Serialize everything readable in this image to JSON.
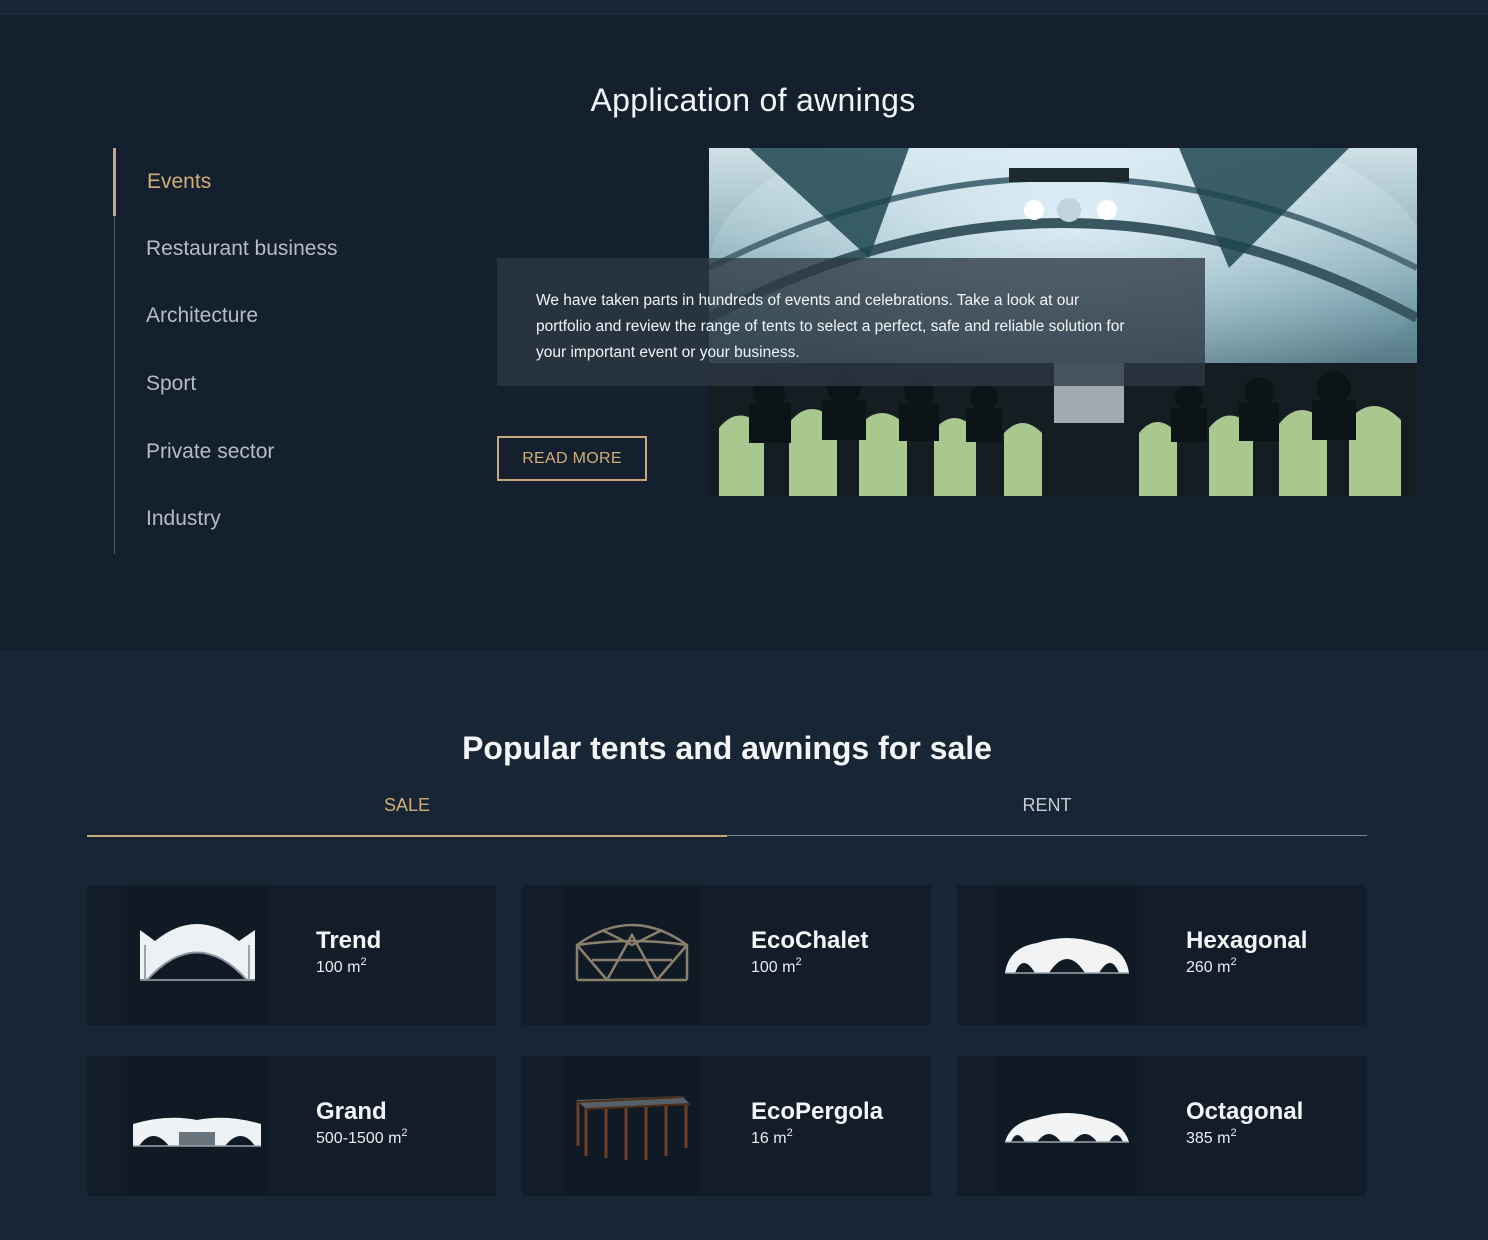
{
  "application": {
    "title": "Application of awnings",
    "nav": [
      {
        "label": "Events",
        "active": true
      },
      {
        "label": "Restaurant business",
        "active": false
      },
      {
        "label": "Architecture",
        "active": false
      },
      {
        "label": "Sport",
        "active": false
      },
      {
        "label": "Private sector",
        "active": false
      },
      {
        "label": "Industry",
        "active": false
      }
    ],
    "description": "We have taken parts in hundreds of events and celebrations. Take a look at our portfolio and review the range of tents to select a perfect, safe and reliable solution for your important event or your business.",
    "read_more": "READ MORE"
  },
  "popular": {
    "title": "Popular tents and awnings for sale",
    "tabs": [
      {
        "label": "SALE",
        "active": true
      },
      {
        "label": "RENT",
        "active": false
      }
    ],
    "products": [
      {
        "name": "Trend",
        "area": "100 m",
        "unit_sup": "2",
        "icon": "trend-tent-icon"
      },
      {
        "name": "EcoChalet",
        "area": "100 m",
        "unit_sup": "2",
        "icon": "ecochalet-frame-icon"
      },
      {
        "name": "Hexagonal",
        "area": "260 m",
        "unit_sup": "2",
        "icon": "hexagonal-tent-icon"
      },
      {
        "name": "Grand",
        "area": "500-1500 m",
        "unit_sup": "2",
        "icon": "grand-tent-icon"
      },
      {
        "name": "EcoPergola",
        "area": "16 m",
        "unit_sup": "2",
        "icon": "ecopergola-icon"
      },
      {
        "name": "Octagonal",
        "area": "385 m",
        "unit_sup": "2",
        "icon": "octagonal-tent-icon"
      }
    ]
  },
  "colors": {
    "background": "#15202e",
    "accent_gold": "#c9a877",
    "card": "#121d29"
  }
}
